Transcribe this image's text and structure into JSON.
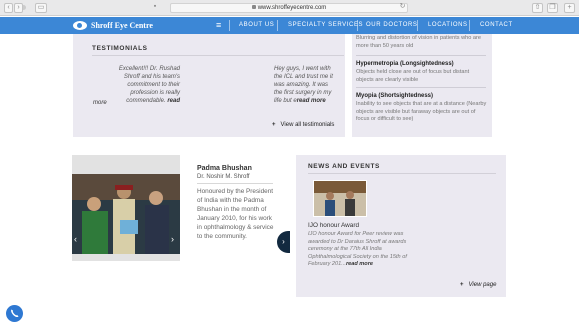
{
  "browser": {
    "url": "www.shroffeyecentre.com"
  },
  "nav": {
    "brand": "Shroff Eye Centre",
    "menu_icon": "hamburger-icon",
    "items": [
      "ABOUT US",
      "SPECIALTY SERVICES",
      "OUR DOCTORS",
      "LOCATIONS",
      "CONTACT"
    ]
  },
  "testimonials": {
    "heading": "TESTIMONIALS",
    "quote1": "Excellent!!! Dr. Rushad Shroff and his team's commitment to their profession is really commendable.",
    "quote1_read": "read",
    "quote1_more": "more",
    "quote2": "Hey guys, I went with the ICL and trust me it was amazing. It was the first surgery in my life but e",
    "quote2_more": "read more",
    "view_all": "View all testimonials"
  },
  "conditions": {
    "intro": "Blurring and distortion of vision in patients who are more than 50 years old",
    "hyper_title": "Hypermetropia (Longsightedness)",
    "hyper_text": "Objects held close are out of focus but distant objects are clearly visible",
    "myopia_title": "Myopia (Shortsightedness)",
    "myopia_text": "Inability to see objects that are at a distance (Nearby objects are visible but faraway objects are out of focus or difficult to see)"
  },
  "award": {
    "title": "Padma Bhushan",
    "person": "Dr. Noshir M. Shroff",
    "body": "Honoured by the President of India with the Padma Bhushan in the month of January 2010, for his work in ophthalmology & service to the community."
  },
  "news": {
    "heading": "NEWS AND EVENTS",
    "item_title": "IJO honour Award",
    "item_body": "IJO honour Award for Peer review was awarded to Dr Daraius Shroff at awards ceremony at the 77th All India Ophthalmological Society on the 15th of February 201...",
    "item_more": "read more",
    "view_page": "View page"
  },
  "colors": {
    "nav": "#3c87d6",
    "panel": "#ebe9f1"
  }
}
